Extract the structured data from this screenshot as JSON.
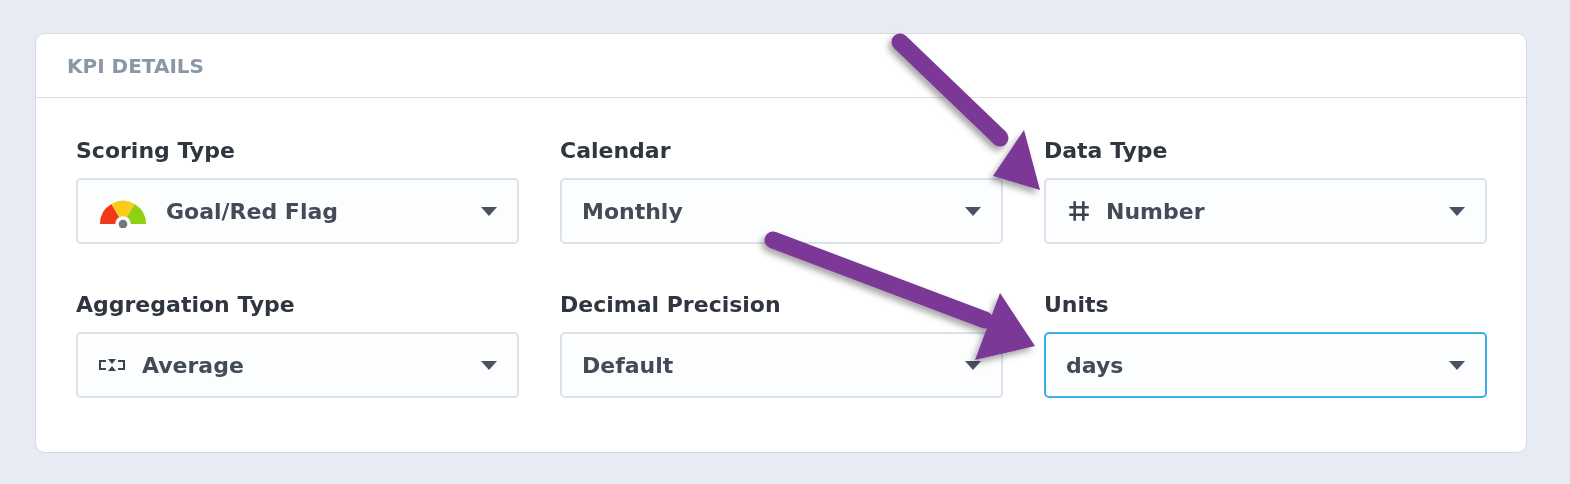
{
  "panel": {
    "title": "KPI DETAILS"
  },
  "fields": [
    {
      "label": "Scoring Type",
      "value": "Goal/Red Flag",
      "kind": "gauge",
      "focused": false
    },
    {
      "label": "Calendar",
      "value": "Monthly",
      "kind": "plain",
      "focused": false
    },
    {
      "label": "Data Type",
      "value": "Number",
      "kind": "hash",
      "focused": false
    },
    {
      "label": "Aggregation Type",
      "value": "Average",
      "kind": "average",
      "focused": false
    },
    {
      "label": "Decimal Precision",
      "value": "Default",
      "kind": "plain",
      "focused": false
    },
    {
      "label": "Units",
      "value": "days",
      "kind": "plain",
      "focused": true
    }
  ]
}
